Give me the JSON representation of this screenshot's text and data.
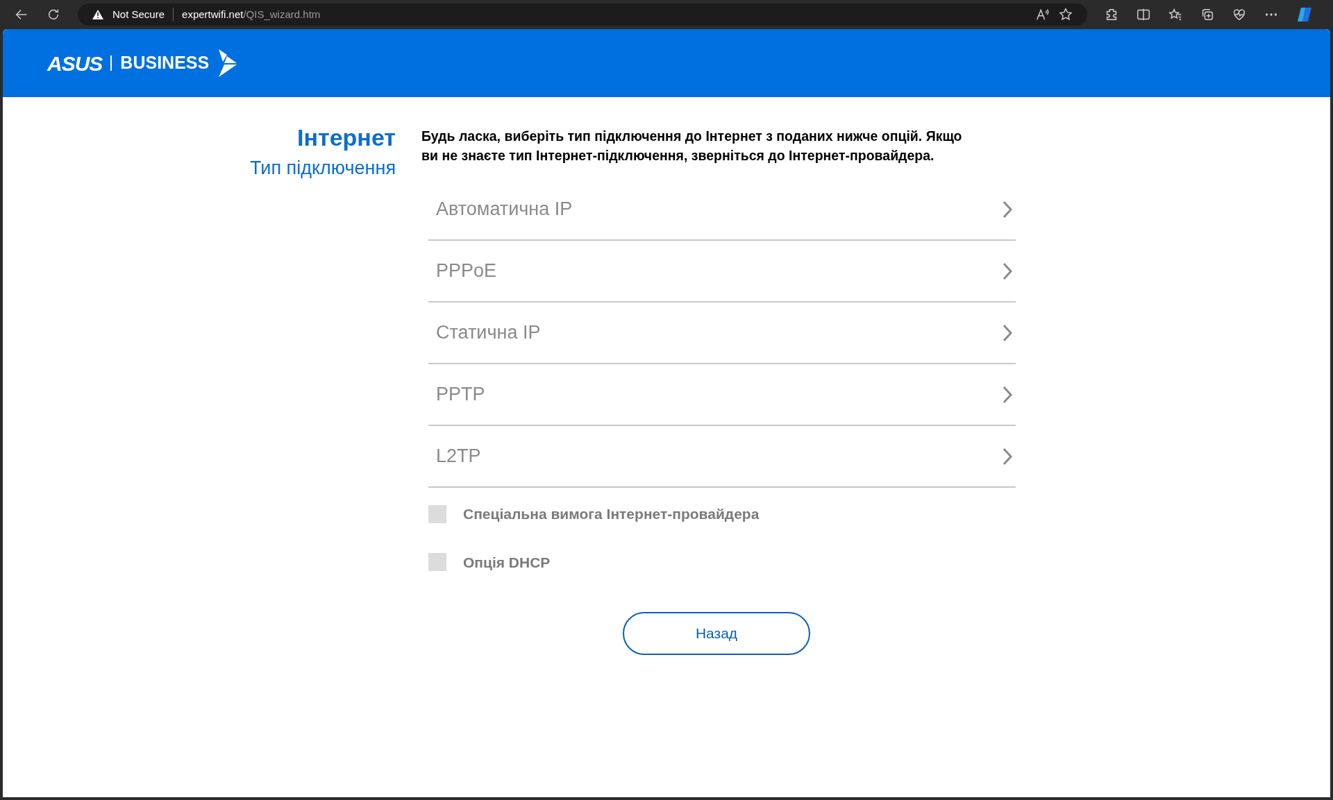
{
  "browser": {
    "security": "Not Secure",
    "url_host": "expertwifi.net",
    "url_path": "/QIS_wizard.htm"
  },
  "logo": {
    "brand": "ASUS",
    "division": "BUSINESS"
  },
  "heading": {
    "title": "Інтернет",
    "subtitle": "Тип підключення"
  },
  "description": "Будь ласка, виберіть тип підключення до Інтернет з поданих нижче опцій. Якщо ви не знаєте тип Інтернет-підключення, зверніться до Інтернет-провайдера.",
  "options": [
    {
      "label": "Автоматична IP"
    },
    {
      "label": "PPPoE"
    },
    {
      "label": "Статична IP"
    },
    {
      "label": "PPTP"
    },
    {
      "label": "L2TP"
    }
  ],
  "checkboxes": [
    {
      "label": "Спеціальна вимога Інтернет-провайдера",
      "checked": false
    },
    {
      "label": "Опція DHCP",
      "checked": false
    }
  ],
  "back_button": "Назад"
}
